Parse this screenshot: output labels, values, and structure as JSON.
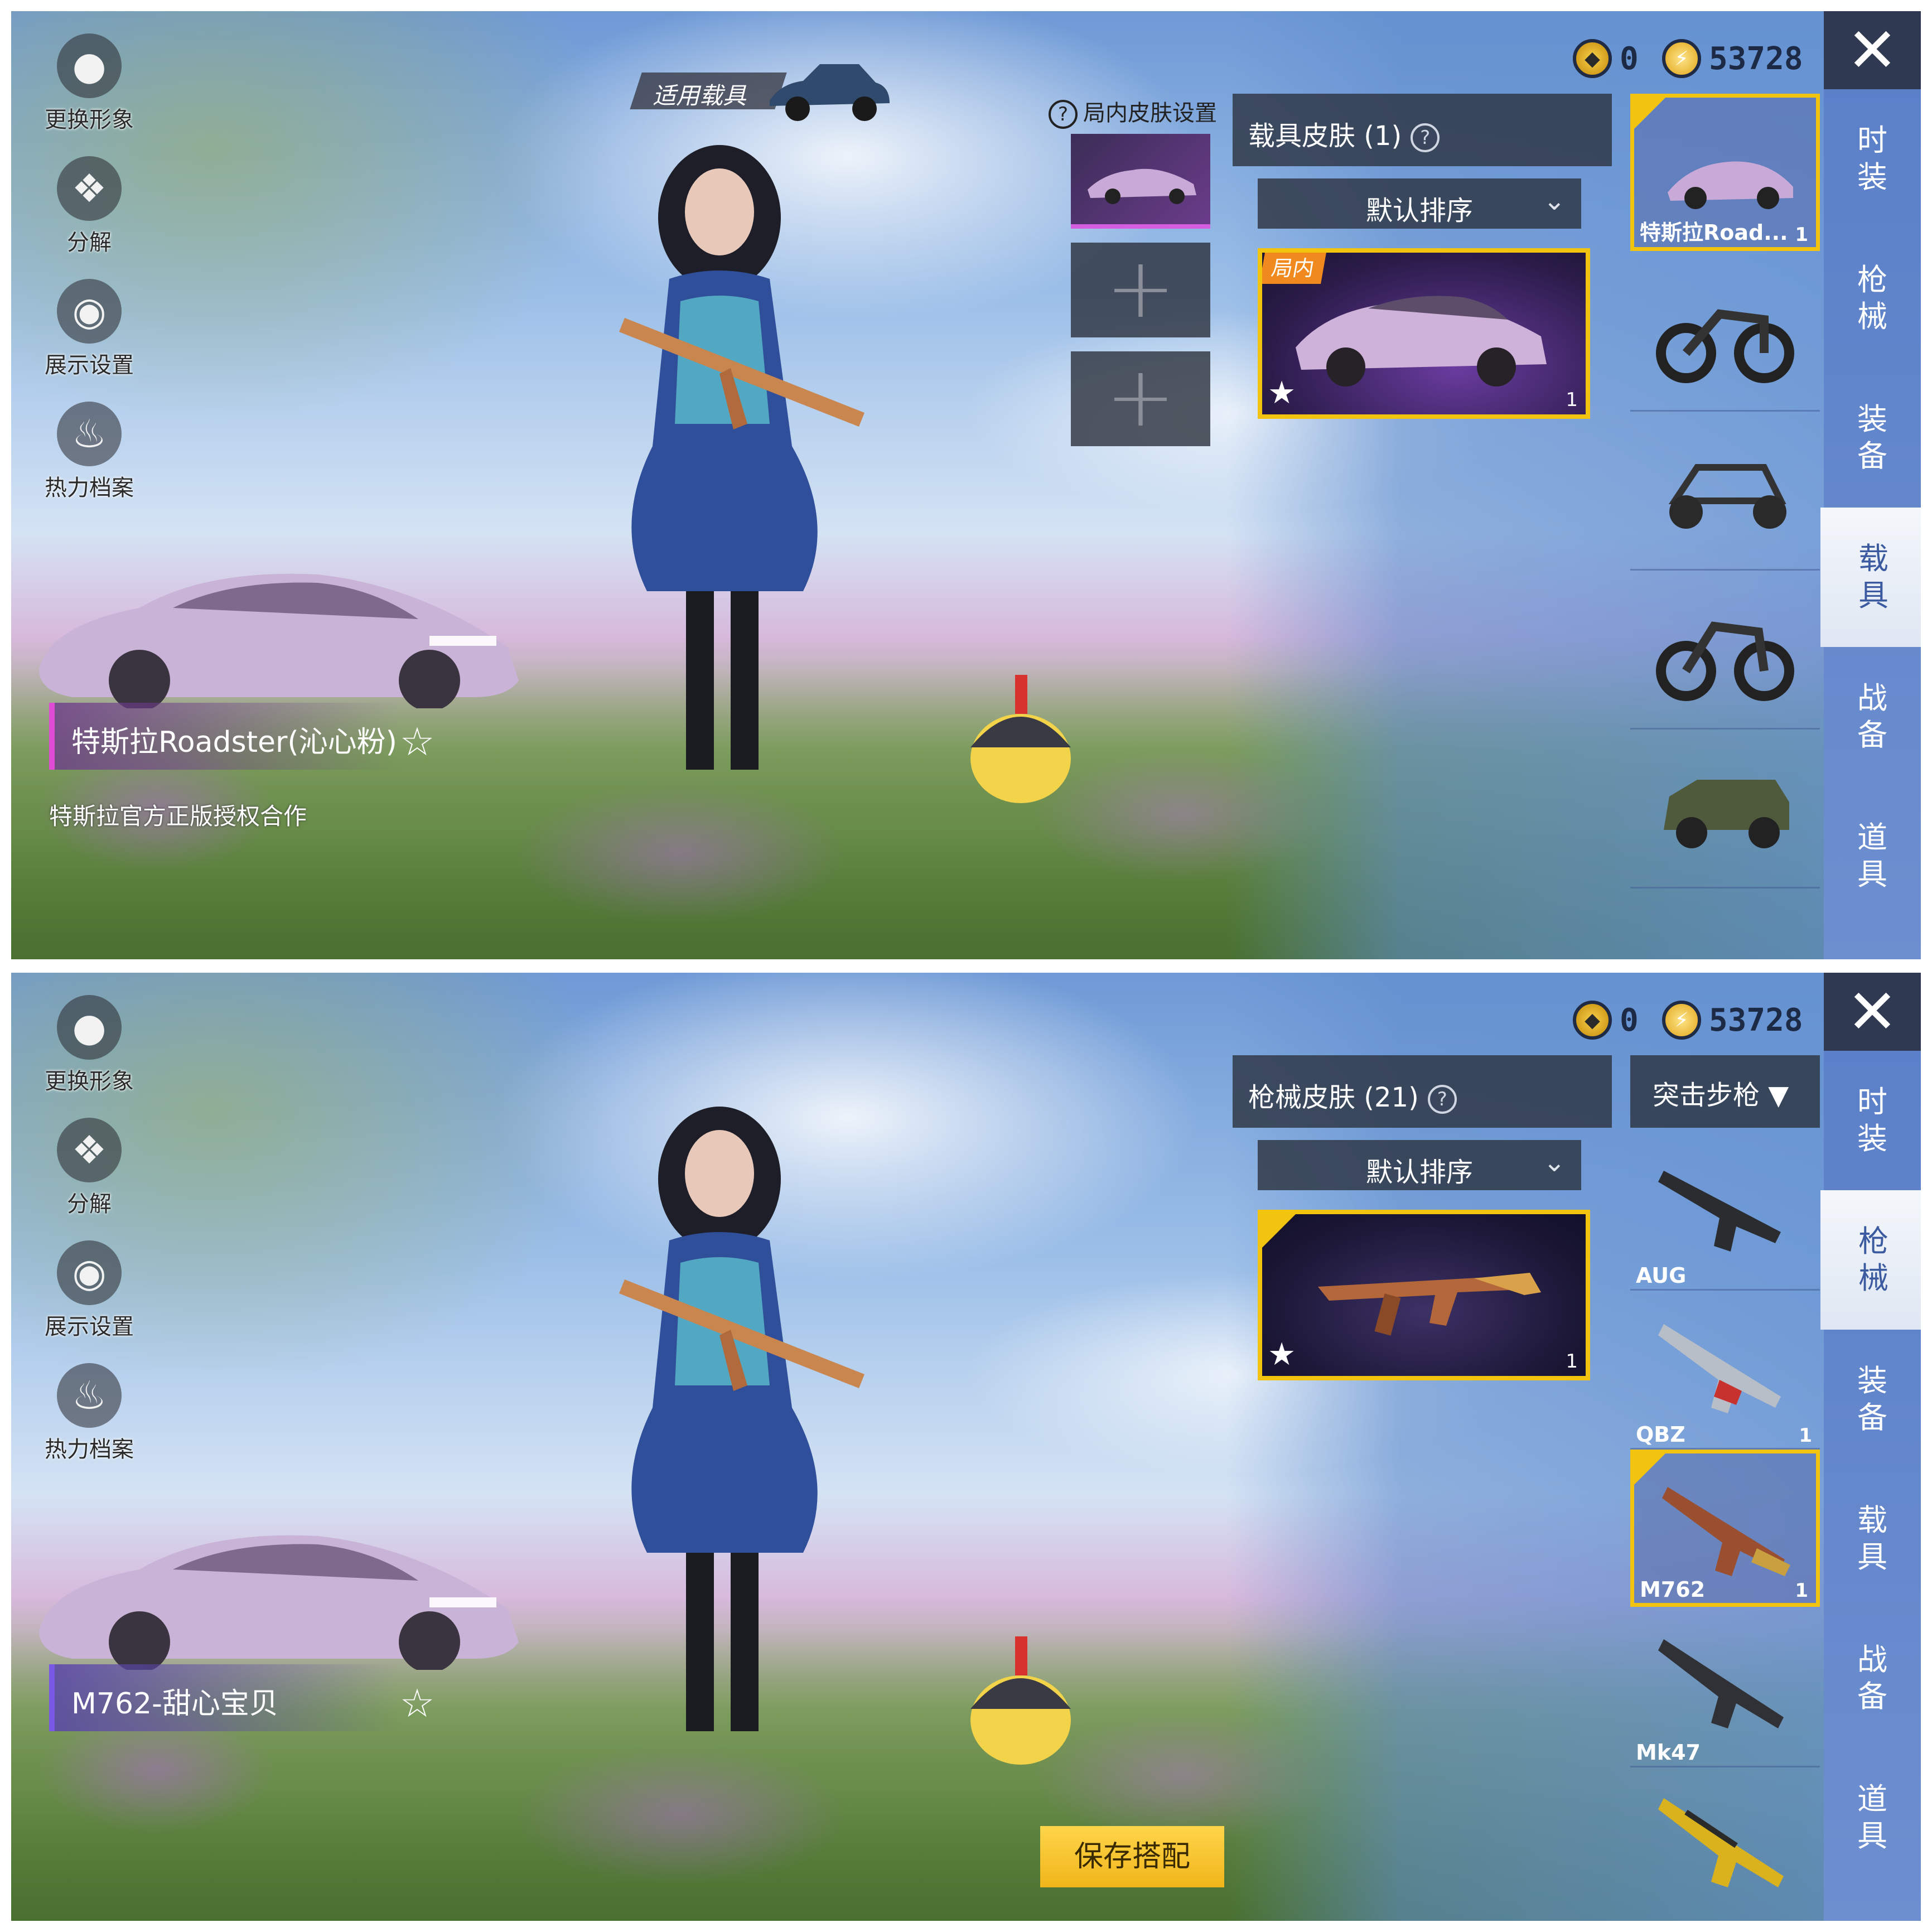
{
  "colors": {
    "accent_gold": "#f3c40f",
    "tab_bar": "#5a7fc8",
    "card_purple": "#6a3ca0"
  },
  "top": {
    "left_menu": [
      {
        "label": "更换形象",
        "icon": "person-icon"
      },
      {
        "label": "分解",
        "icon": "puzzle-icon"
      },
      {
        "label": "展示设置",
        "icon": "eye-icon"
      },
      {
        "label": "热力档案",
        "icon": "flame-icon"
      }
    ],
    "vehicle_tag": "适用载具",
    "ingame_skin_setting": "局内皮肤设置",
    "currency": {
      "uc_value": "0",
      "bp_value": "53728"
    },
    "category_title": "载具皮肤 (1)",
    "sort_label": "默认排序",
    "skin_card": {
      "badge": "局内",
      "count": "1"
    },
    "item_title": "特斯拉Roadster(沁心粉)",
    "item_subtitle": "特斯拉官方正版授权合作",
    "vehicle_list": [
      {
        "label": "特斯拉Road...",
        "count": "1",
        "icon": "tesla-roadster-icon",
        "selected": true
      },
      {
        "label": "",
        "count": "",
        "icon": "motorcycle-icon",
        "selected": false
      },
      {
        "label": "",
        "count": "",
        "icon": "buggy-icon",
        "selected": false
      },
      {
        "label": "",
        "count": "",
        "icon": "motorcycle-sidecar-icon",
        "selected": false
      },
      {
        "label": "",
        "count": "",
        "icon": "uaz-jeep-icon",
        "selected": false
      }
    ],
    "tabs": [
      "时装",
      "枪械",
      "装备",
      "载具",
      "战备",
      "道具"
    ],
    "active_tab": "载具"
  },
  "bottom": {
    "left_menu": [
      {
        "label": "更换形象",
        "icon": "person-icon"
      },
      {
        "label": "分解",
        "icon": "puzzle-icon"
      },
      {
        "label": "展示设置",
        "icon": "eye-icon"
      },
      {
        "label": "热力档案",
        "icon": "flame-icon"
      }
    ],
    "currency": {
      "uc_value": "0",
      "bp_value": "53728"
    },
    "category_title": "枪械皮肤 (21)",
    "sort_label": "默认排序",
    "weapon_category": "突击步枪",
    "skin_card": {
      "count": "1"
    },
    "item_title": "M762-甜心宝贝",
    "weapon_list": [
      {
        "label": "AUG",
        "count": "",
        "icon": "aug-rifle-icon",
        "selected": false
      },
      {
        "label": "QBZ",
        "count": "1",
        "icon": "qbz-rifle-icon",
        "selected": false
      },
      {
        "label": "M762",
        "count": "1",
        "icon": "m762-rifle-icon",
        "selected": true
      },
      {
        "label": "Mk47",
        "count": "",
        "icon": "mk47-rifle-icon",
        "selected": false
      },
      {
        "label": "",
        "count": "",
        "icon": "gold-rifle-icon",
        "selected": false
      }
    ],
    "tabs": [
      "时装",
      "枪械",
      "装备",
      "载具",
      "战备",
      "道具"
    ],
    "active_tab": "枪械",
    "save_button": "保存搭配"
  }
}
